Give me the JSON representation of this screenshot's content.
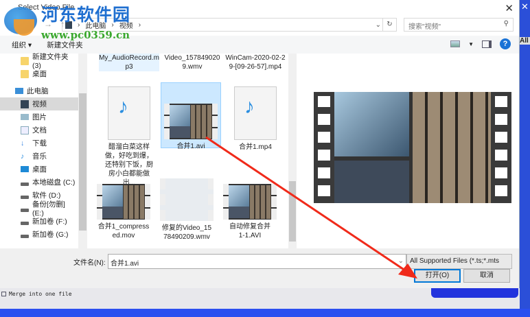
{
  "window": {
    "title": "Select Video File"
  },
  "watermark": {
    "name": "河东软件园",
    "url": "www.pc0359.cn"
  },
  "address": {
    "crumbs": [
      "此电脑",
      "视频"
    ],
    "search_placeholder": "搜索\"视频\""
  },
  "toolbar": {
    "organize": "组织 ▾",
    "new_folder": "新建文件夹"
  },
  "sidebar": {
    "items": [
      {
        "label": "新建文件夹 (3)",
        "icon": "folder-icon"
      },
      {
        "label": "桌面",
        "icon": "folder-icon"
      },
      {
        "label": "此电脑",
        "icon": "computer-icon"
      },
      {
        "label": "视频",
        "icon": "video-icon",
        "selected": true
      },
      {
        "label": "图片",
        "icon": "pictures-icon"
      },
      {
        "label": "文档",
        "icon": "documents-icon"
      },
      {
        "label": "下载",
        "icon": "download-icon"
      },
      {
        "label": "音乐",
        "icon": "music-icon"
      },
      {
        "label": "桌面",
        "icon": "desktop-icon"
      },
      {
        "label": "本地磁盘 (C:)",
        "icon": "drive-icon"
      },
      {
        "label": "软件 (D:)",
        "icon": "drive-icon"
      },
      {
        "label": "备份[勿删] (E:)",
        "icon": "drive-icon"
      },
      {
        "label": "新加卷 (F:)",
        "icon": "drive-icon"
      },
      {
        "label": "新加卷 (G:)",
        "icon": "drive-icon"
      }
    ]
  },
  "files": [
    {
      "name": "My_AudioRecord.mp3"
    },
    {
      "name": "Video_1578490209.wmv"
    },
    {
      "name": "WinCam-2020-02-29-[09-26-57].mp4"
    },
    {
      "name": "醋溜白菜这样做，好吃到爆，还特别下饭，厨房小白都能做出..."
    },
    {
      "name": "合并1.avi"
    },
    {
      "name": "合并1.mp4"
    },
    {
      "name": "合并1_compressed.mov"
    },
    {
      "name": "修复的Video_1578490209.wmv"
    },
    {
      "name": "自动修复合并1-1.AVI"
    }
  ],
  "footer": {
    "filename_label": "文件名(N):",
    "filename_value": "合并1.avi",
    "filter": "All Supported Files (*.ts;*.mts",
    "open": "打开(O)",
    "cancel": "取消"
  },
  "app": {
    "merge_label": "Merge into one file",
    "side_label": "All"
  }
}
